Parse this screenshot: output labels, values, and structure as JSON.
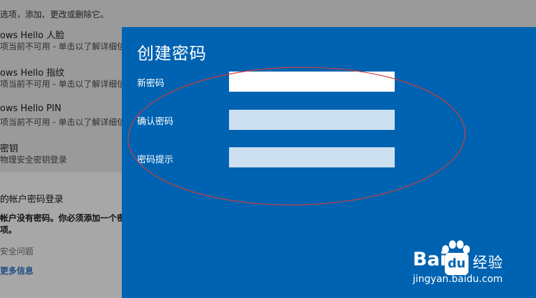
{
  "background_page": {
    "intro_text": "选项，添加、更改或删除它。",
    "items": [
      {
        "title": "ows Hello 人脸",
        "subtitle": "项当前不可用 - 单击以了解详细信"
      },
      {
        "title": "ows Hello 指纹",
        "subtitle": "项当前不可用 - 单击以了解详细信"
      },
      {
        "title": "ows Hello PIN",
        "subtitle": "项当前不可用 - 单击以了解详细信"
      },
      {
        "title": "密钥",
        "subtitle": "物理安全密钥登录"
      }
    ],
    "password_section": {
      "title": "的帐户密码登录",
      "note_line1": "帐户没有密码。你必须添加一个密",
      "note_line2": "项。"
    },
    "security_questions": "安全问题",
    "more_info": "更多信息"
  },
  "dialog": {
    "title": "创建密码",
    "fields": [
      {
        "label": "新密码",
        "value": ""
      },
      {
        "label": "确认密码",
        "value": ""
      },
      {
        "label": "密码提示",
        "value": ""
      }
    ]
  },
  "colors": {
    "dialog_bg": "#0063b1",
    "annotation": "#d23a3a"
  },
  "watermark": {
    "logo_text": "Bai",
    "logo_text_b": "du",
    "logo_cn": "经验",
    "url": "jingyan.baidu.com"
  }
}
